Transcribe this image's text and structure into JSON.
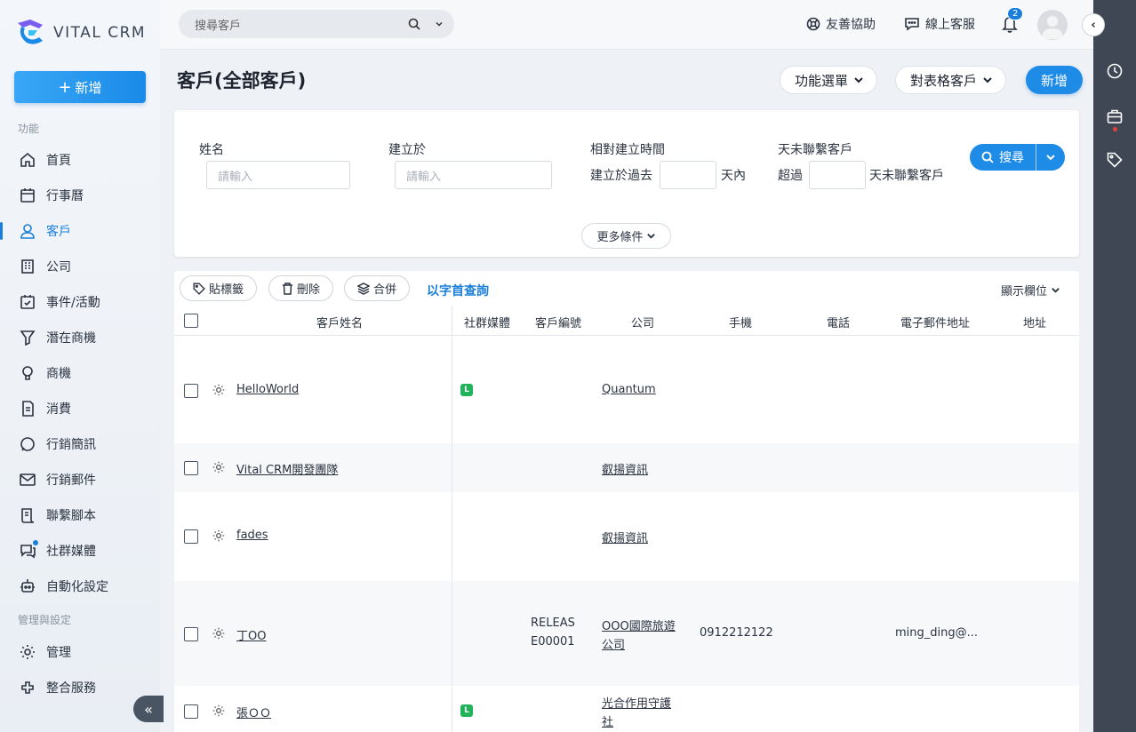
{
  "app": {
    "logo_text": "VITAL CRM",
    "new_button": "新增"
  },
  "sidebar": {
    "section_features": "功能",
    "section_admin": "管理與設定",
    "items": [
      {
        "label": "首頁",
        "icon": "home-icon"
      },
      {
        "label": "行事曆",
        "icon": "calendar-icon"
      },
      {
        "label": "客戶",
        "icon": "customer-icon",
        "active": true
      },
      {
        "label": "公司",
        "icon": "company-icon"
      },
      {
        "label": "事件/活動",
        "icon": "event-icon"
      },
      {
        "label": "潛在商機",
        "icon": "lead-icon"
      },
      {
        "label": "商機",
        "icon": "opportunity-icon"
      },
      {
        "label": "消費",
        "icon": "purchase-icon"
      },
      {
        "label": "行銷簡訊",
        "icon": "sms-icon"
      },
      {
        "label": "行銷郵件",
        "icon": "mail-icon"
      },
      {
        "label": "聯繫腳本",
        "icon": "script-icon"
      },
      {
        "label": "社群媒體",
        "icon": "social-icon",
        "has_dot": true
      },
      {
        "label": "自動化設定",
        "icon": "automation-icon"
      }
    ],
    "admin_items": [
      {
        "label": "管理",
        "icon": "settings-icon"
      },
      {
        "label": "整合服務",
        "icon": "integration-icon"
      }
    ]
  },
  "topbar": {
    "search_placeholder": "搜尋客戶",
    "help_label": "友善協助",
    "support_label": "線上客服",
    "notification_count": "2"
  },
  "page": {
    "title": "客戶(全部客戶)",
    "menu_button": "功能選單",
    "table_button": "對表格客戶",
    "add_button": "新增"
  },
  "filter": {
    "name_label": "姓名",
    "name_placeholder": "請輸入",
    "created_label": "建立於",
    "created_placeholder": "請輸入",
    "relative_label": "相對建立時間",
    "relative_prefix": "建立於過去",
    "relative_suffix": "天內",
    "no_contact_label": "天未聯繫客戶",
    "no_contact_prefix": "超過",
    "no_contact_suffix": "天未聯繫客戶",
    "search_button": "搜尋",
    "more_button": "更多條件"
  },
  "toolbar": {
    "tag_button": "貼標籤",
    "delete_button": "刪除",
    "merge_button": "合併",
    "alpha_link": "以字首查詢",
    "columns_toggle": "顯示欄位"
  },
  "table": {
    "columns": [
      "客戶姓名",
      "社群媒體",
      "客戶編號",
      "公司",
      "手機",
      "電話",
      "電子郵件地址",
      "地址"
    ],
    "rows": [
      {
        "name": "HelloWorld",
        "line": true,
        "code1": "",
        "code2": "",
        "company1": "Quantum",
        "company2": "",
        "mobile": "",
        "email": ""
      },
      {
        "name": "Vital CRM開發團隊",
        "line": false,
        "code1": "",
        "code2": "",
        "company1": "叡揚資訊",
        "company2": "",
        "mobile": "",
        "email": ""
      },
      {
        "name": "fades",
        "line": false,
        "code1": "",
        "code2": "",
        "company1": "叡揚資訊",
        "company2": "",
        "mobile": "",
        "email": ""
      },
      {
        "name": "丁OO",
        "line": false,
        "code1": "RELEAS",
        "code2": "E00001",
        "company1": "OOO國際旅遊",
        "company2": "公司",
        "mobile": "0912212122",
        "email": "ming_ding@..."
      },
      {
        "name": "張ＯＯ",
        "line": true,
        "code1": "",
        "code2": "",
        "company1": "光合作用守護",
        "company2": "社",
        "mobile": "",
        "email": ""
      }
    ]
  },
  "colors": {
    "accent": "#1e8be6",
    "rail": "#3e4753",
    "line_green": "#21b35a"
  }
}
